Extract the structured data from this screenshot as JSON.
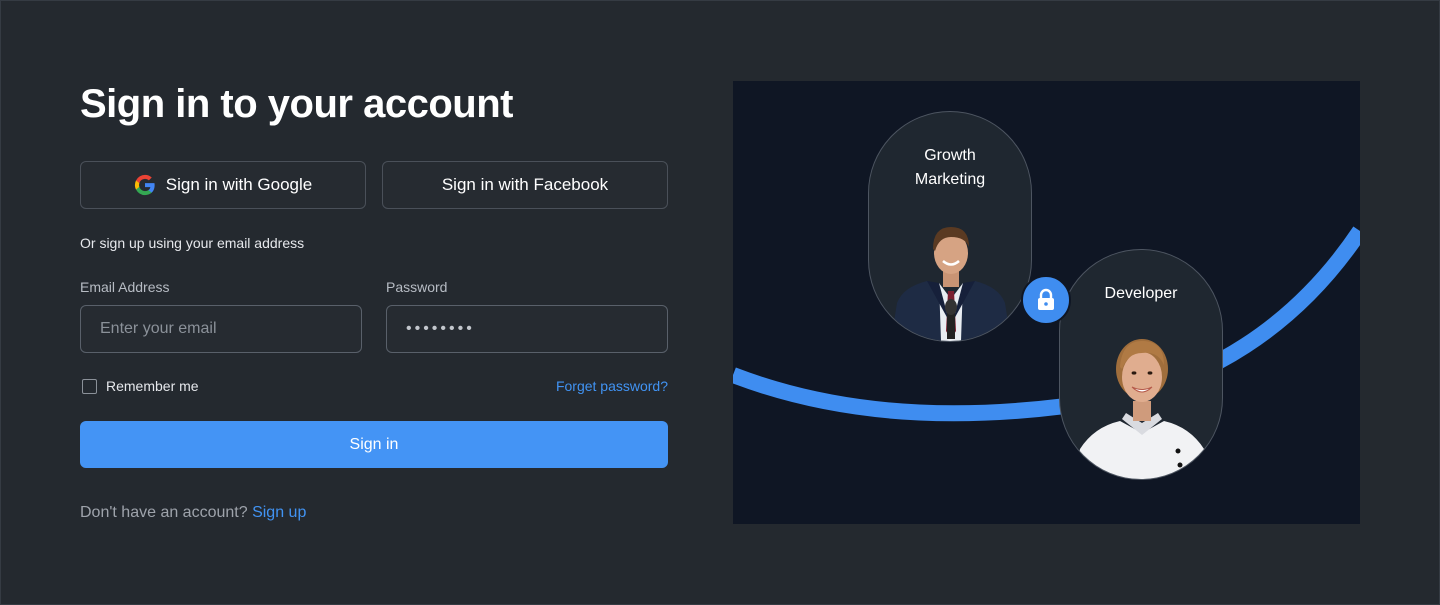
{
  "login": {
    "title": "Sign in to your account",
    "google_label": "Sign in with Google",
    "facebook_label": "Sign in with Facebook",
    "or_text": "Or sign up using your email address",
    "email_label": "Email Address",
    "email_placeholder": "Enter your email",
    "password_label": "Password",
    "password_value": "••••••••",
    "remember_label": "Remember me",
    "forgot_label": "Forget password?",
    "signin_label": "Sign in",
    "no_account_text": "Don't have an account?",
    "signup_label": "Sign up"
  },
  "illustration": {
    "card1_line1": "Growth",
    "card1_line2": "Marketing",
    "card2_label": "Developer",
    "lock_icon": "lock-icon"
  },
  "colors": {
    "background": "#24292f",
    "accent": "#4494f5",
    "panel": "#0f1624",
    "link": "#4193f3"
  }
}
